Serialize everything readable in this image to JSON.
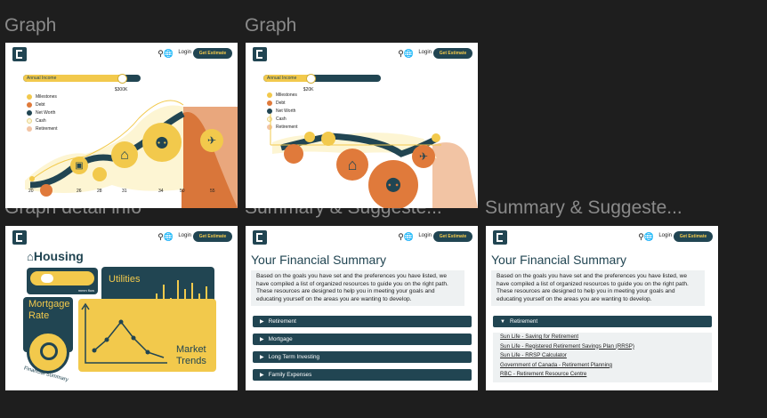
{
  "canvas_labels": [
    "Graph",
    "Graph",
    "Graph detail info",
    "Summary & Suggeste...",
    "Summary & Suggeste..."
  ],
  "header": {
    "login": "Login",
    "cta": "Get Estimate"
  },
  "income_label": "Annual Income",
  "frame1": {
    "income_value": "$300K",
    "income_fill": 0.84,
    "x_ticks": [
      "20",
      "26",
      "28",
      "31",
      "34",
      "50",
      "55"
    ]
  },
  "frame2": {
    "income_value": "$20K",
    "income_fill": 0.4
  },
  "legend": [
    {
      "label": "Milestones",
      "color": "#f2c94c"
    },
    {
      "label": "Debt",
      "color": "#e07a3b"
    },
    {
      "label": "Net Worth",
      "color": "#214552"
    },
    {
      "label": "Cash",
      "color": "#fdf5d3"
    },
    {
      "label": "Retirement",
      "color": "#f2c4a4"
    }
  ],
  "detail": {
    "housing": "Housing",
    "utilities": "Utilities",
    "mortgage_rate": [
      "Mortgage",
      "Rate"
    ],
    "market_trends": [
      "Market",
      "Trends"
    ],
    "financial_summary": "Financial Summary",
    "toggle_caption": "mmm flow"
  },
  "summary": {
    "title": "Your Financial Summary",
    "intro": "Based on the goals you have set and the preferences you have listed, we have compiled a list of organized resources to guide you on the right path. These resources are designed to help you in meeting your goals and educating yourself on the areas you are wanting to develop.",
    "sections": [
      "Retirement",
      "Mortgage",
      "Long Term Investing",
      "Family Expenses"
    ],
    "expanded_section": "Retirement",
    "retirement_links": [
      "Sun Life - Saving for Retirement",
      "Sun Life - Registered Retirement Savings Plan (RRSP)",
      "Sun Life - RRSP Calculator",
      "Government of Canada - Retirement Planning",
      "RBC - Retirement Resource Centre"
    ]
  }
}
